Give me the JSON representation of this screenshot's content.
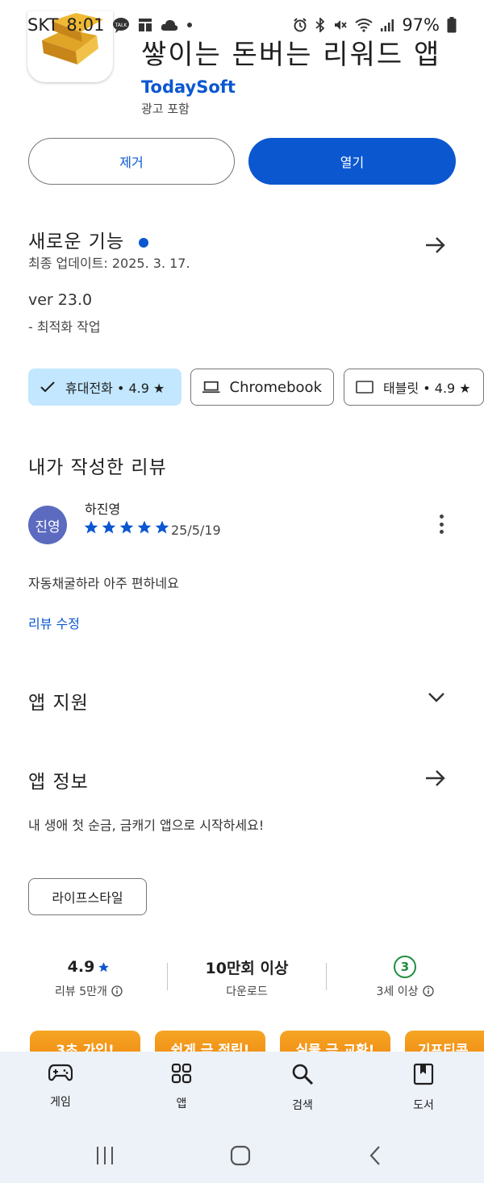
{
  "status_bar": {
    "carrier": "SKT",
    "time": "8:01",
    "battery": "97%",
    "left_icons": [
      "talk-icon",
      "gallery-icon",
      "cloud-icon",
      "dot-icon"
    ],
    "right_icons": [
      "alarm-icon",
      "bluetooth-icon",
      "mute-icon",
      "wifi-icon",
      "signal-icon",
      "battery-icon"
    ]
  },
  "app": {
    "title": "쌓이는 돈버는 리워드 앱",
    "developer": "TodaySoft",
    "ads_note": "광고 포함"
  },
  "actions": {
    "uninstall_label": "제거",
    "open_label": "열기"
  },
  "whats_new": {
    "title": "새로운 기능",
    "updated": "최종 업데이트: 2025. 3. 17.",
    "version": "ver 23.0",
    "notes": "- 최적화 작업"
  },
  "device_chips": [
    {
      "label": "휴대전화 • 4.9 ★",
      "selected": true
    },
    {
      "label": "Chromebook",
      "selected": false
    },
    {
      "label": "태블릿 • 4.9 ★",
      "selected": false
    }
  ],
  "my_review": {
    "section_title": "내가 작성한 리뷰",
    "avatar_text": "진영",
    "reviewer": "하진영",
    "stars": 5,
    "date": "25/5/19",
    "text": "자동채굴하라 아주 편하네요",
    "edit_label": "리뷰 수정"
  },
  "app_support": {
    "title": "앱 지원"
  },
  "app_info": {
    "title": "앱 정보",
    "description": "내 생애 첫 순금, 금캐기 앱으로 시작하세요!",
    "tag": "라이프스타일"
  },
  "stats": {
    "rating_value": "4.9",
    "rating_label": "리뷰 5만개",
    "downloads_value": "10만회 이상",
    "downloads_label": "다운로드",
    "age_value": "3",
    "age_label": "3세 이상"
  },
  "promos": [
    "3초 가입!",
    "쉽게 금 적립!",
    "실물 금 교환!",
    "기프티콘 교"
  ],
  "bottom_nav": {
    "items": [
      {
        "label": "게임",
        "icon": "gamepad-icon"
      },
      {
        "label": "앱",
        "icon": "apps-grid-icon"
      },
      {
        "label": "검색",
        "icon": "search-icon"
      },
      {
        "label": "도서",
        "icon": "book-icon"
      }
    ]
  },
  "colors": {
    "accent": "#0b57d0",
    "chip_selected": "#c2e7ff",
    "promo": "#f5a524",
    "nav_bg": "#edf1f8",
    "age_green": "#1e8e3e"
  }
}
